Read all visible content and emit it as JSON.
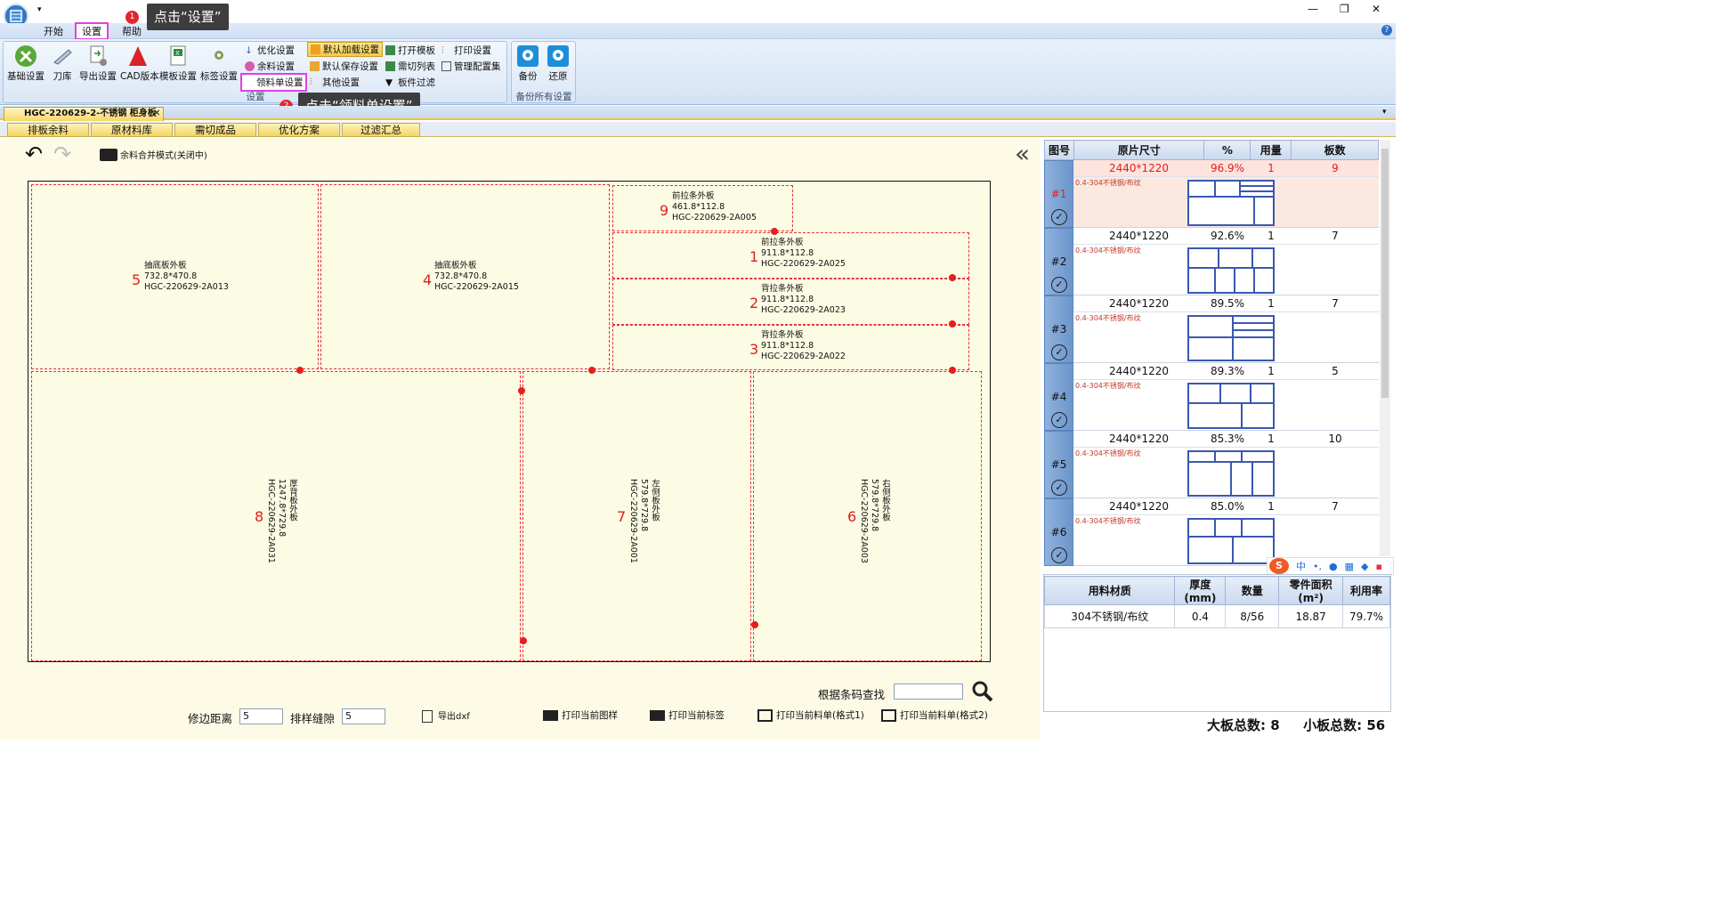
{
  "window": {
    "title_controls": [
      "—",
      "❐",
      "✕"
    ],
    "help": "?"
  },
  "menu": {
    "items": [
      "开始",
      "设置",
      "帮助"
    ]
  },
  "ribbon": {
    "big_buttons": [
      "基础设置",
      "刀库",
      "导出设置",
      "CAD版本",
      "模板设置",
      "标签设置"
    ],
    "col1": [
      "优化设置",
      "余料设置",
      "领料单设置"
    ],
    "col2": [
      "默认加载设置",
      "默认保存设置",
      "其他设置"
    ],
    "col3": [
      "打开模板",
      "需切列表",
      "板件过滤"
    ],
    "col4": [
      "打印设置",
      "管理配置集"
    ],
    "group1_label": "设置",
    "group2_buttons": [
      "备份",
      "还原"
    ],
    "group2_label": "备份所有设置"
  },
  "callouts": [
    {
      "num": "1",
      "text": "点击“设置”"
    },
    {
      "num": "2",
      "text": "点击“领料单设置”"
    }
  ],
  "doc_tab": "HGC-220629-2-不锈钢 柜身板",
  "sub_tabs": [
    "排板余料",
    "原材料库",
    "需切成品",
    "优化方案",
    "过滤汇总"
  ],
  "toolbar": {
    "merge_mode": "余料合并模式(关闭中)"
  },
  "parts": [
    {
      "num": "5",
      "name": "抽底板外板",
      "size": "732.8*470.8",
      "code": "HGC-220629-2A013"
    },
    {
      "num": "4",
      "name": "抽底板外板",
      "size": "732.8*470.8",
      "code": "HGC-220629-2A015"
    },
    {
      "num": "9",
      "name": "前拉条外板",
      "size": "461.8*112.8",
      "code": "HGC-220629-2A005"
    },
    {
      "num": "1",
      "name": "前拉条外板",
      "size": "911.8*112.8",
      "code": "HGC-220629-2A025"
    },
    {
      "num": "2",
      "name": "背拉条外板",
      "size": "911.8*112.8",
      "code": "HGC-220629-2A023"
    },
    {
      "num": "3",
      "name": "背拉条外板",
      "size": "911.8*112.8",
      "code": "HGC-220629-2A022"
    },
    {
      "num": "8",
      "name": "厚背板外板",
      "size": "1247.8*729.8",
      "code": "HGC-220629-2A031"
    },
    {
      "num": "7",
      "name": "左侧板外板",
      "size": "579.8*729.8",
      "code": "HGC-220629-2A001"
    },
    {
      "num": "6",
      "name": "右侧板外板",
      "size": "579.8*729.8",
      "code": "HGC-220629-2A003"
    }
  ],
  "bottom": {
    "trim_label": "修边距离",
    "trim_value": "5",
    "gap_label": "排样缝隙",
    "gap_value": "5",
    "export": "导出dxf",
    "print_pattern": "打印当前图样",
    "print_label": "打印当前标签",
    "print_list1": "打印当前料单(格式1)",
    "print_list2": "打印当前料单(格式2)",
    "search_label": "根据条码查找"
  },
  "sheet_list": {
    "headers": [
      "图号",
      "原片尺寸",
      "%",
      "用量",
      "板数"
    ],
    "rows": [
      {
        "id": "#1",
        "size": "2440*1220",
        "pct": "96.9%",
        "qty": "1",
        "count": "9",
        "material": "0.4-304不锈钢/布纹"
      },
      {
        "id": "#2",
        "size": "2440*1220",
        "pct": "92.6%",
        "qty": "1",
        "count": "7",
        "material": "0.4-304不锈钢/布纹"
      },
      {
        "id": "#3",
        "size": "2440*1220",
        "pct": "89.5%",
        "qty": "1",
        "count": "7",
        "material": "0.4-304不锈钢/布纹"
      },
      {
        "id": "#4",
        "size": "2440*1220",
        "pct": "89.3%",
        "qty": "1",
        "count": "5",
        "material": "0.4-304不锈钢/布纹"
      },
      {
        "id": "#5",
        "size": "2440*1220",
        "pct": "85.3%",
        "qty": "1",
        "count": "10",
        "material": "0.4-304不锈钢/布纹"
      },
      {
        "id": "#6",
        "size": "2440*1220",
        "pct": "85.0%",
        "qty": "1",
        "count": "7",
        "material": "0.4-304不锈钢/布纹"
      }
    ]
  },
  "ime": [
    "中",
    "•,"
  ],
  "summary": {
    "headers": [
      "用料材质",
      "厚度(mm)",
      "数量",
      "零件面积(m²)",
      "利用率"
    ],
    "row": [
      "304不锈钢/布纹",
      "0.4",
      "8/56",
      "18.87",
      "79.7%"
    ]
  },
  "totals": {
    "big_label": "大板总数:",
    "big": "8",
    "small_label": "小板总数:",
    "small": "56"
  },
  "colors": {
    "accent": "#e3262d",
    "highlight": "#e040e0",
    "board": "#fcfbe4"
  }
}
